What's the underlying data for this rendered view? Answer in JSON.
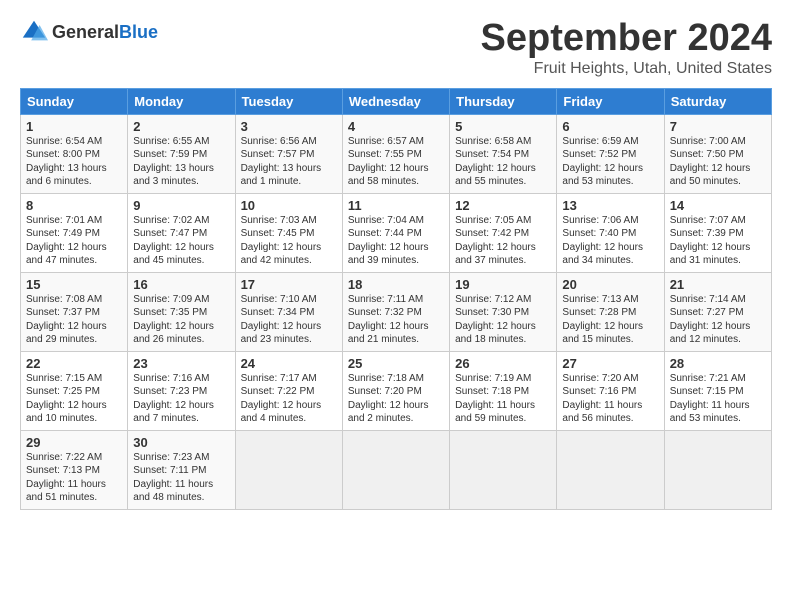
{
  "logo": {
    "text_general": "General",
    "text_blue": "Blue"
  },
  "title": {
    "month": "September 2024",
    "location": "Fruit Heights, Utah, United States"
  },
  "calendar": {
    "headers": [
      "Sunday",
      "Monday",
      "Tuesday",
      "Wednesday",
      "Thursday",
      "Friday",
      "Saturday"
    ],
    "rows": [
      [
        {
          "day": "1",
          "sunrise": "Sunrise: 6:54 AM",
          "sunset": "Sunset: 8:00 PM",
          "daylight": "Daylight: 13 hours and 6 minutes."
        },
        {
          "day": "2",
          "sunrise": "Sunrise: 6:55 AM",
          "sunset": "Sunset: 7:59 PM",
          "daylight": "Daylight: 13 hours and 3 minutes."
        },
        {
          "day": "3",
          "sunrise": "Sunrise: 6:56 AM",
          "sunset": "Sunset: 7:57 PM",
          "daylight": "Daylight: 13 hours and 1 minute."
        },
        {
          "day": "4",
          "sunrise": "Sunrise: 6:57 AM",
          "sunset": "Sunset: 7:55 PM",
          "daylight": "Daylight: 12 hours and 58 minutes."
        },
        {
          "day": "5",
          "sunrise": "Sunrise: 6:58 AM",
          "sunset": "Sunset: 7:54 PM",
          "daylight": "Daylight: 12 hours and 55 minutes."
        },
        {
          "day": "6",
          "sunrise": "Sunrise: 6:59 AM",
          "sunset": "Sunset: 7:52 PM",
          "daylight": "Daylight: 12 hours and 53 minutes."
        },
        {
          "day": "7",
          "sunrise": "Sunrise: 7:00 AM",
          "sunset": "Sunset: 7:50 PM",
          "daylight": "Daylight: 12 hours and 50 minutes."
        }
      ],
      [
        {
          "day": "8",
          "sunrise": "Sunrise: 7:01 AM",
          "sunset": "Sunset: 7:49 PM",
          "daylight": "Daylight: 12 hours and 47 minutes."
        },
        {
          "day": "9",
          "sunrise": "Sunrise: 7:02 AM",
          "sunset": "Sunset: 7:47 PM",
          "daylight": "Daylight: 12 hours and 45 minutes."
        },
        {
          "day": "10",
          "sunrise": "Sunrise: 7:03 AM",
          "sunset": "Sunset: 7:45 PM",
          "daylight": "Daylight: 12 hours and 42 minutes."
        },
        {
          "day": "11",
          "sunrise": "Sunrise: 7:04 AM",
          "sunset": "Sunset: 7:44 PM",
          "daylight": "Daylight: 12 hours and 39 minutes."
        },
        {
          "day": "12",
          "sunrise": "Sunrise: 7:05 AM",
          "sunset": "Sunset: 7:42 PM",
          "daylight": "Daylight: 12 hours and 37 minutes."
        },
        {
          "day": "13",
          "sunrise": "Sunrise: 7:06 AM",
          "sunset": "Sunset: 7:40 PM",
          "daylight": "Daylight: 12 hours and 34 minutes."
        },
        {
          "day": "14",
          "sunrise": "Sunrise: 7:07 AM",
          "sunset": "Sunset: 7:39 PM",
          "daylight": "Daylight: 12 hours and 31 minutes."
        }
      ],
      [
        {
          "day": "15",
          "sunrise": "Sunrise: 7:08 AM",
          "sunset": "Sunset: 7:37 PM",
          "daylight": "Daylight: 12 hours and 29 minutes."
        },
        {
          "day": "16",
          "sunrise": "Sunrise: 7:09 AM",
          "sunset": "Sunset: 7:35 PM",
          "daylight": "Daylight: 12 hours and 26 minutes."
        },
        {
          "day": "17",
          "sunrise": "Sunrise: 7:10 AM",
          "sunset": "Sunset: 7:34 PM",
          "daylight": "Daylight: 12 hours and 23 minutes."
        },
        {
          "day": "18",
          "sunrise": "Sunrise: 7:11 AM",
          "sunset": "Sunset: 7:32 PM",
          "daylight": "Daylight: 12 hours and 21 minutes."
        },
        {
          "day": "19",
          "sunrise": "Sunrise: 7:12 AM",
          "sunset": "Sunset: 7:30 PM",
          "daylight": "Daylight: 12 hours and 18 minutes."
        },
        {
          "day": "20",
          "sunrise": "Sunrise: 7:13 AM",
          "sunset": "Sunset: 7:28 PM",
          "daylight": "Daylight: 12 hours and 15 minutes."
        },
        {
          "day": "21",
          "sunrise": "Sunrise: 7:14 AM",
          "sunset": "Sunset: 7:27 PM",
          "daylight": "Daylight: 12 hours and 12 minutes."
        }
      ],
      [
        {
          "day": "22",
          "sunrise": "Sunrise: 7:15 AM",
          "sunset": "Sunset: 7:25 PM",
          "daylight": "Daylight: 12 hours and 10 minutes."
        },
        {
          "day": "23",
          "sunrise": "Sunrise: 7:16 AM",
          "sunset": "Sunset: 7:23 PM",
          "daylight": "Daylight: 12 hours and 7 minutes."
        },
        {
          "day": "24",
          "sunrise": "Sunrise: 7:17 AM",
          "sunset": "Sunset: 7:22 PM",
          "daylight": "Daylight: 12 hours and 4 minutes."
        },
        {
          "day": "25",
          "sunrise": "Sunrise: 7:18 AM",
          "sunset": "Sunset: 7:20 PM",
          "daylight": "Daylight: 12 hours and 2 minutes."
        },
        {
          "day": "26",
          "sunrise": "Sunrise: 7:19 AM",
          "sunset": "Sunset: 7:18 PM",
          "daylight": "Daylight: 11 hours and 59 minutes."
        },
        {
          "day": "27",
          "sunrise": "Sunrise: 7:20 AM",
          "sunset": "Sunset: 7:16 PM",
          "daylight": "Daylight: 11 hours and 56 minutes."
        },
        {
          "day": "28",
          "sunrise": "Sunrise: 7:21 AM",
          "sunset": "Sunset: 7:15 PM",
          "daylight": "Daylight: 11 hours and 53 minutes."
        }
      ],
      [
        {
          "day": "29",
          "sunrise": "Sunrise: 7:22 AM",
          "sunset": "Sunset: 7:13 PM",
          "daylight": "Daylight: 11 hours and 51 minutes."
        },
        {
          "day": "30",
          "sunrise": "Sunrise: 7:23 AM",
          "sunset": "Sunset: 7:11 PM",
          "daylight": "Daylight: 11 hours and 48 minutes."
        },
        null,
        null,
        null,
        null,
        null
      ]
    ]
  }
}
